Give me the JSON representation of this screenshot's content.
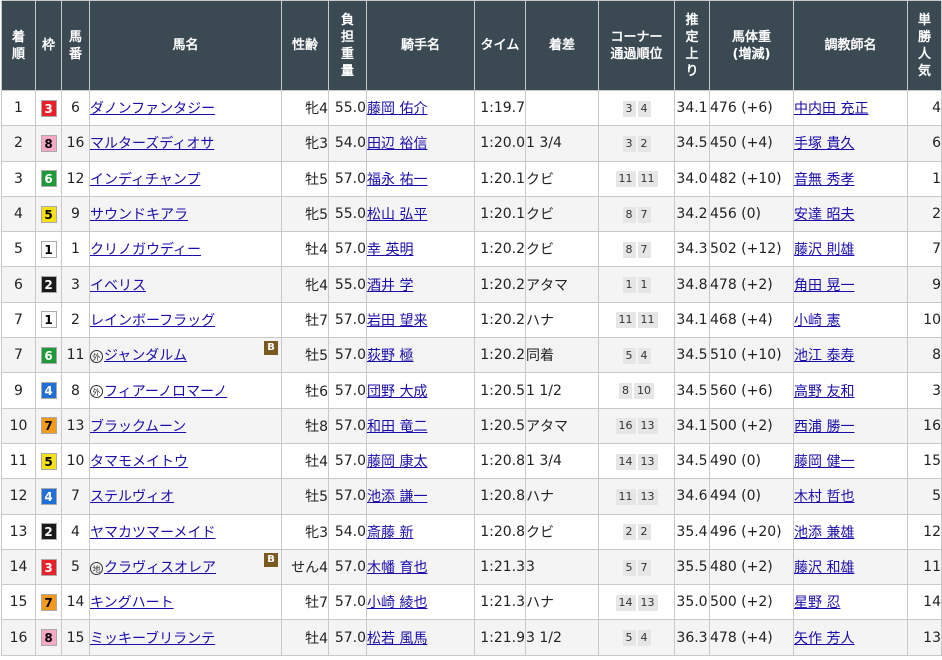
{
  "headers": {
    "rank": "着順",
    "waku": "枠",
    "umaban": "馬番",
    "horse": "馬名",
    "sexage": "性齢",
    "weight": "負担重量",
    "jockey": "騎手名",
    "time": "タイム",
    "margin": "着差",
    "corner_line1": "コーナー",
    "corner_line2": "通過順位",
    "last3f": "推定上り",
    "bodyweight_line1": "馬体重",
    "bodyweight_line2": "(増減)",
    "trainer": "調教師名",
    "pop": "単勝人気"
  },
  "waku_colors": {
    "1": {
      "bg": "#ffffff",
      "fg": "#000000"
    },
    "2": {
      "bg": "#1a1a1a",
      "fg": "#ffffff"
    },
    "3": {
      "bg": "#e8202a",
      "fg": "#ffffff"
    },
    "4": {
      "bg": "#1f6fd6",
      "fg": "#ffffff"
    },
    "5": {
      "bg": "#f5e01a",
      "fg": "#000000"
    },
    "6": {
      "bg": "#1e9a3a",
      "fg": "#ffffff"
    },
    "7": {
      "bg": "#f39a1c",
      "fg": "#000000"
    },
    "8": {
      "bg": "#f7a8c6",
      "fg": "#000000"
    }
  },
  "rows": [
    {
      "rank": "1",
      "waku": "3",
      "umaban": "6",
      "mark": "",
      "horse": "ダノンファンタジー",
      "blinker": "",
      "sexage": "牝4",
      "weight": "55.0",
      "jockey": "藤岡 佑介",
      "time": "1:19.7",
      "margin": "",
      "corner": [
        "3",
        "4"
      ],
      "last3f": "34.1",
      "bodyweight": "476 (+6)",
      "trainer": "中内田 充正",
      "pop": "4"
    },
    {
      "rank": "2",
      "waku": "8",
      "umaban": "16",
      "mark": "",
      "horse": "マルターズディオサ",
      "blinker": "",
      "sexage": "牝3",
      "weight": "54.0",
      "jockey": "田辺 裕信",
      "time": "1:20.0",
      "margin": "1 3/4",
      "corner": [
        "3",
        "2"
      ],
      "last3f": "34.5",
      "bodyweight": "450 (+4)",
      "trainer": "手塚 貴久",
      "pop": "6"
    },
    {
      "rank": "3",
      "waku": "6",
      "umaban": "12",
      "mark": "",
      "horse": "インディチャンプ",
      "blinker": "",
      "sexage": "牡5",
      "weight": "57.0",
      "jockey": "福永 祐一",
      "time": "1:20.1",
      "margin": "クビ",
      "corner": [
        "11",
        "11"
      ],
      "last3f": "34.0",
      "bodyweight": "482 (+10)",
      "trainer": "音無 秀孝",
      "pop": "1"
    },
    {
      "rank": "4",
      "waku": "5",
      "umaban": "9",
      "mark": "",
      "horse": "サウンドキアラ",
      "blinker": "",
      "sexage": "牝5",
      "weight": "55.0",
      "jockey": "松山 弘平",
      "time": "1:20.1",
      "margin": "クビ",
      "corner": [
        "8",
        "7"
      ],
      "last3f": "34.2",
      "bodyweight": "456 (0)",
      "trainer": "安達 昭夫",
      "pop": "2"
    },
    {
      "rank": "5",
      "waku": "1",
      "umaban": "1",
      "mark": "",
      "horse": "クリノガウディー",
      "blinker": "",
      "sexage": "牡4",
      "weight": "57.0",
      "jockey": "幸 英明",
      "time": "1:20.2",
      "margin": "クビ",
      "corner": [
        "8",
        "7"
      ],
      "last3f": "34.3",
      "bodyweight": "502 (+12)",
      "trainer": "藤沢 則雄",
      "pop": "7"
    },
    {
      "rank": "6",
      "waku": "2",
      "umaban": "3",
      "mark": "",
      "horse": "イベリス",
      "blinker": "",
      "sexage": "牝4",
      "weight": "55.0",
      "jockey": "酒井 学",
      "time": "1:20.2",
      "margin": "アタマ",
      "corner": [
        "1",
        "1"
      ],
      "last3f": "34.8",
      "bodyweight": "478 (+2)",
      "trainer": "角田 晃一",
      "pop": "9"
    },
    {
      "rank": "7",
      "waku": "1",
      "umaban": "2",
      "mark": "",
      "horse": "レインボーフラッグ",
      "blinker": "",
      "sexage": "牡7",
      "weight": "57.0",
      "jockey": "岩田 望来",
      "time": "1:20.2",
      "margin": "ハナ",
      "corner": [
        "11",
        "11"
      ],
      "last3f": "34.1",
      "bodyweight": "468 (+4)",
      "trainer": "小崎 憲",
      "pop": "10"
    },
    {
      "rank": "7",
      "waku": "6",
      "umaban": "11",
      "mark": "外",
      "horse": "ジャンダルム",
      "blinker": "B",
      "sexage": "牡5",
      "weight": "57.0",
      "jockey": "荻野 極",
      "time": "1:20.2",
      "margin": "同着",
      "corner": [
        "5",
        "4"
      ],
      "last3f": "34.5",
      "bodyweight": "510 (+10)",
      "trainer": "池江 泰寿",
      "pop": "8"
    },
    {
      "rank": "9",
      "waku": "4",
      "umaban": "8",
      "mark": "外",
      "horse": "フィアーノロマーノ",
      "blinker": "",
      "sexage": "牡6",
      "weight": "57.0",
      "jockey": "団野 大成",
      "time": "1:20.5",
      "margin": "1 1/2",
      "corner": [
        "8",
        "10"
      ],
      "last3f": "34.5",
      "bodyweight": "560 (+6)",
      "trainer": "高野 友和",
      "pop": "3"
    },
    {
      "rank": "10",
      "waku": "7",
      "umaban": "13",
      "mark": "",
      "horse": "ブラックムーン",
      "blinker": "",
      "sexage": "牡8",
      "weight": "57.0",
      "jockey": "和田 竜二",
      "time": "1:20.5",
      "margin": "アタマ",
      "corner": [
        "16",
        "13"
      ],
      "last3f": "34.1",
      "bodyweight": "500 (+2)",
      "trainer": "西浦 勝一",
      "pop": "16"
    },
    {
      "rank": "11",
      "waku": "5",
      "umaban": "10",
      "mark": "",
      "horse": "タマモメイトウ",
      "blinker": "",
      "sexage": "牡4",
      "weight": "57.0",
      "jockey": "藤岡 康太",
      "time": "1:20.8",
      "margin": "1 3/4",
      "corner": [
        "14",
        "13"
      ],
      "last3f": "34.5",
      "bodyweight": "490 (0)",
      "trainer": "藤岡 健一",
      "pop": "15"
    },
    {
      "rank": "12",
      "waku": "4",
      "umaban": "7",
      "mark": "",
      "horse": "ステルヴィオ",
      "blinker": "",
      "sexage": "牡5",
      "weight": "57.0",
      "jockey": "池添 謙一",
      "time": "1:20.8",
      "margin": "ハナ",
      "corner": [
        "11",
        "13"
      ],
      "last3f": "34.6",
      "bodyweight": "494 (0)",
      "trainer": "木村 哲也",
      "pop": "5"
    },
    {
      "rank": "13",
      "waku": "2",
      "umaban": "4",
      "mark": "",
      "horse": "ヤマカツマーメイド",
      "blinker": "",
      "sexage": "牝3",
      "weight": "54.0",
      "jockey": "斎藤 新",
      "time": "1:20.8",
      "margin": "クビ",
      "corner": [
        "2",
        "2"
      ],
      "last3f": "35.4",
      "bodyweight": "496 (+20)",
      "trainer": "池添 兼雄",
      "pop": "12"
    },
    {
      "rank": "14",
      "waku": "3",
      "umaban": "5",
      "mark": "地",
      "horse": "クラヴィスオレア",
      "blinker": "B",
      "sexage": "せん4",
      "weight": "57.0",
      "jockey": "木幡 育也",
      "time": "1:21.3",
      "margin": "3",
      "corner": [
        "5",
        "7"
      ],
      "last3f": "35.5",
      "bodyweight": "480 (+2)",
      "trainer": "藤沢 和雄",
      "pop": "11"
    },
    {
      "rank": "15",
      "waku": "7",
      "umaban": "14",
      "mark": "",
      "horse": "キングハート",
      "blinker": "",
      "sexage": "牡7",
      "weight": "57.0",
      "jockey": "小崎 綾也",
      "time": "1:21.3",
      "margin": "ハナ",
      "corner": [
        "14",
        "13"
      ],
      "last3f": "35.0",
      "bodyweight": "500 (+2)",
      "trainer": "星野 忍",
      "pop": "14"
    },
    {
      "rank": "16",
      "waku": "8",
      "umaban": "15",
      "mark": "",
      "horse": "ミッキーブリランテ",
      "blinker": "",
      "sexage": "牡4",
      "weight": "57.0",
      "jockey": "松若 風馬",
      "time": "1:21.9",
      "margin": "3 1/2",
      "corner": [
        "5",
        "4"
      ],
      "last3f": "36.3",
      "bodyweight": "478 (+4)",
      "trainer": "矢作 芳人",
      "pop": "13"
    }
  ]
}
